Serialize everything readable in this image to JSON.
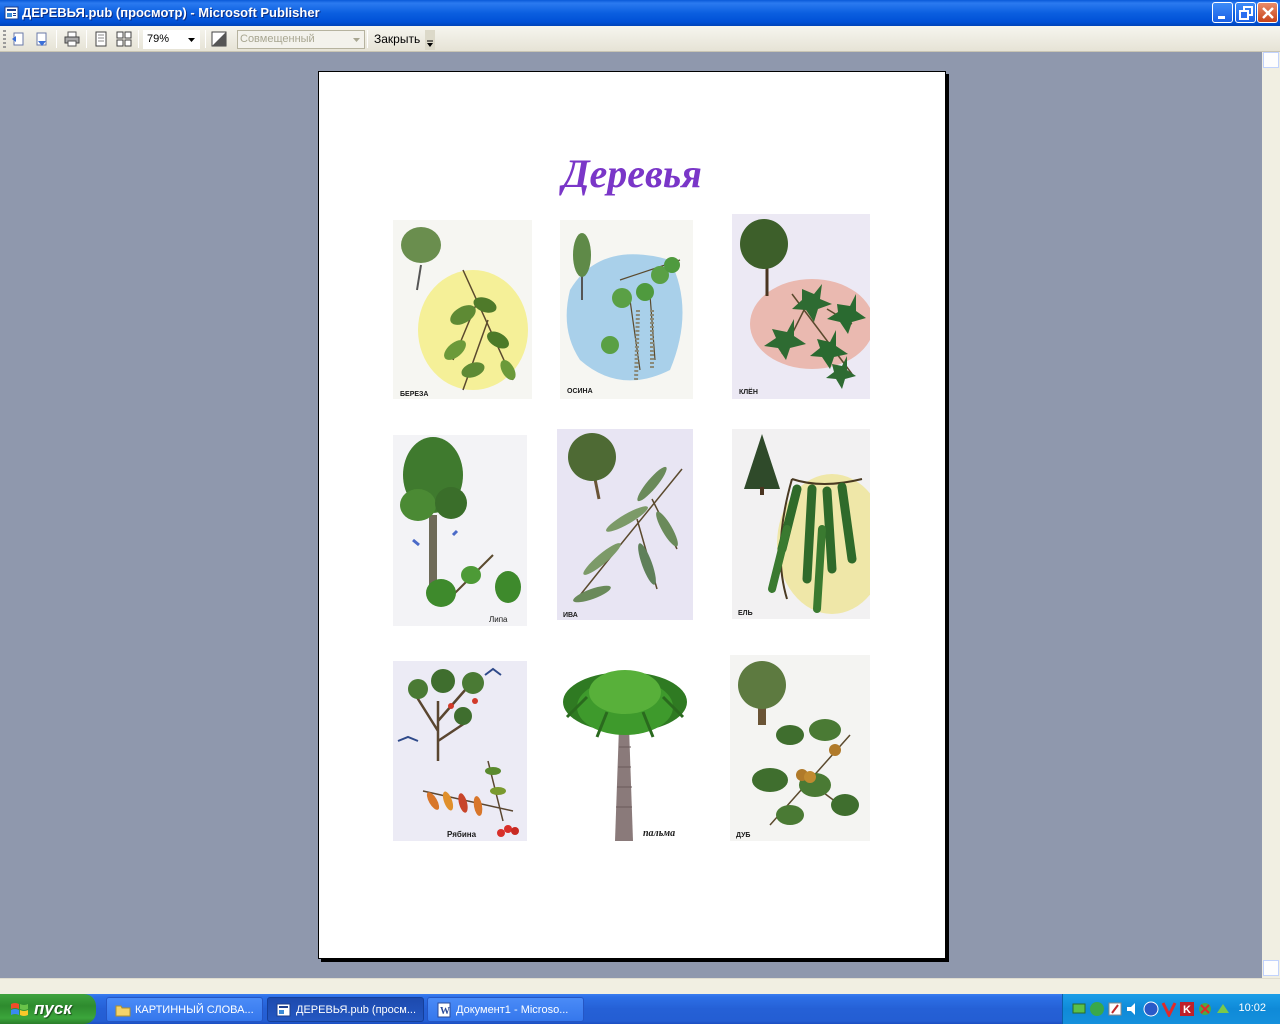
{
  "window": {
    "title": "ДЕРЕВЬЯ.pub (просмотр)  - Microsoft Publisher"
  },
  "toolbar": {
    "zoom_value": "79%",
    "layout_value": "Совмещенный",
    "close_label": "Закрыть"
  },
  "page": {
    "title": "Деревья",
    "title_color": "#7a36c8",
    "trees": [
      {
        "caption": "БЕРЕЗА",
        "icon": "birch-image"
      },
      {
        "caption": "ОСИНА",
        "icon": "aspen-image"
      },
      {
        "caption": "КЛЁН",
        "icon": "maple-image"
      },
      {
        "caption": "Липа",
        "icon": "linden-image"
      },
      {
        "caption": "ИВА",
        "icon": "willow-image"
      },
      {
        "caption": "ЕЛЬ",
        "icon": "spruce-image"
      },
      {
        "caption": "Рябина",
        "icon": "rowan-image"
      },
      {
        "caption": "пальма",
        "icon": "palm-image"
      },
      {
        "caption": "ДУБ",
        "icon": "oak-image"
      }
    ]
  },
  "taskbar": {
    "start_label": "пуск",
    "tasks": [
      {
        "label": "КАРТИННЫЙ СЛОВА..."
      },
      {
        "label": "ДЕРЕВЬЯ.pub (просм..."
      },
      {
        "label": "Документ1 - Microso..."
      }
    ],
    "clock": "10:02"
  },
  "colors": {
    "workspace": "#8f98ad",
    "titlebar": "#0b5fe0",
    "taskbar": "#245ed3",
    "start": "#3ba53b"
  }
}
